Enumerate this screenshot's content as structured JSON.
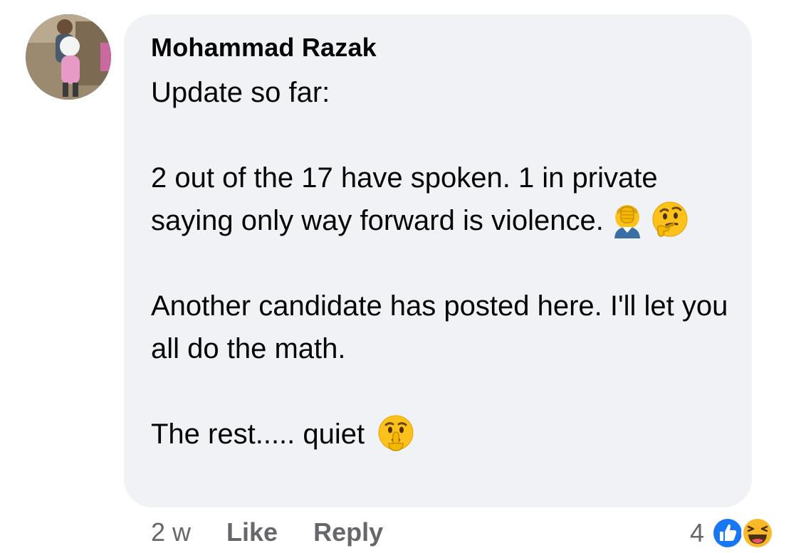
{
  "comment": {
    "author": "Mohammad Razak",
    "paragraphs": [
      {
        "text": "Update so far:"
      },
      {
        "text": "2 out of the 17 have spoken. 1 in private saying only way forward is violence.",
        "emojis": [
          "face-palm-emoji",
          "thinking-face-emoji"
        ]
      },
      {
        "text": "Another candidate has posted here. I'll let you all do the math."
      },
      {
        "text": "The rest..... quiet",
        "emojis": [
          "shushing-face-emoji"
        ]
      }
    ],
    "timestamp": "2 w",
    "like_label": "Like",
    "reply_label": "Reply",
    "reaction_count": "4",
    "reactions": [
      "like-reaction-icon",
      "haha-reaction-icon"
    ]
  },
  "colors": {
    "bubble_bg": "#f0f2f5",
    "secondary_text": "#65676b",
    "like_blue": "#1877f2",
    "haha_yellow": "#f7b928"
  }
}
